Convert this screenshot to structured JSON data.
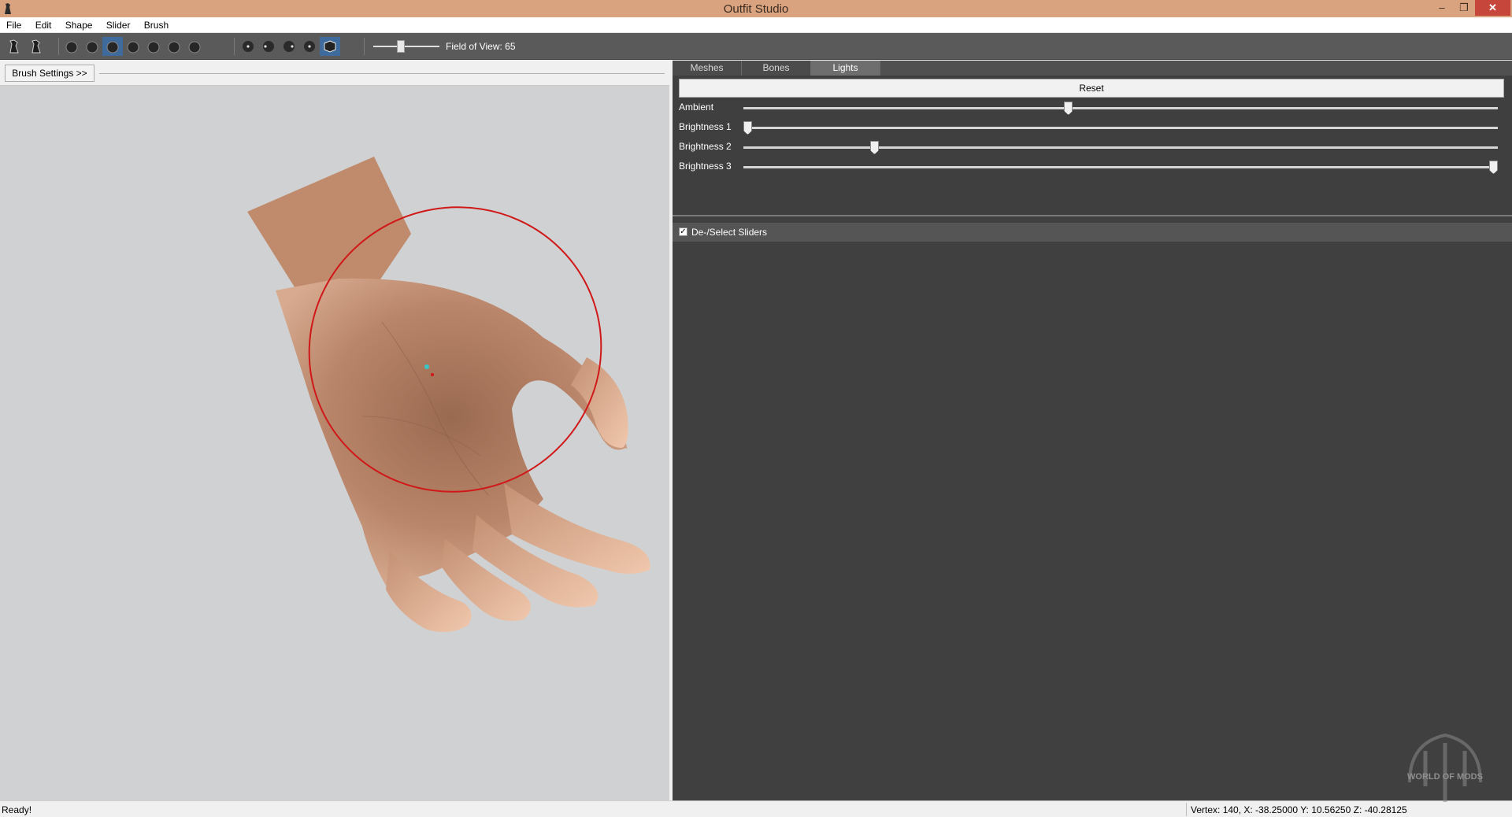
{
  "window": {
    "title": "Outfit Studio",
    "min_glyph": "–",
    "max_glyph": "❐",
    "close_glyph": "✕"
  },
  "menu": [
    "File",
    "Edit",
    "Shape",
    "Slider",
    "Brush"
  ],
  "toolbar": {
    "tools": [
      {
        "name": "select-tool-icon",
        "active": false
      },
      {
        "name": "transform-tool-icon",
        "active": false
      },
      {
        "name": "mask-brush-icon",
        "active": false
      },
      {
        "name": "move-brush-icon",
        "active": false
      },
      {
        "name": "inflate-brush-icon",
        "active": true
      },
      {
        "name": "deflate-brush-icon",
        "active": false
      },
      {
        "name": "smooth-brush-icon",
        "active": false
      },
      {
        "name": "undiff-brush-icon",
        "active": false
      },
      {
        "name": "weight-brush-icon",
        "active": false
      },
      {
        "name": "view-front-icon",
        "active": false
      },
      {
        "name": "view-back-icon",
        "active": false
      },
      {
        "name": "view-left-icon",
        "active": false
      },
      {
        "name": "view-right-icon",
        "active": false
      },
      {
        "name": "perspective-toggle-icon",
        "active": true
      }
    ],
    "fov_label": "Field of View: 65",
    "fov_value": 65,
    "fov_fraction": 0.42
  },
  "left": {
    "brush_settings_label": "Brush Settings >>"
  },
  "tabs": [
    {
      "label": "Meshes",
      "active": false
    },
    {
      "label": "Bones",
      "active": false
    },
    {
      "label": "Lights",
      "active": true
    }
  ],
  "lights": {
    "reset_label": "Reset",
    "rows": [
      {
        "label": "Ambient",
        "value": 0.43
      },
      {
        "label": "Brightness 1",
        "value": 0.0
      },
      {
        "label": "Brightness 2",
        "value": 0.17
      },
      {
        "label": "Brightness 3",
        "value": 1.0
      }
    ]
  },
  "sliders": {
    "deselect_label": "De-/Select Sliders",
    "deselect_checked": true,
    "check_glyph": "✓"
  },
  "status": {
    "left": "Ready!",
    "right": "Vertex: 140, X: -38.25000 Y: 10.56250 Z: -40.28125"
  },
  "watermark": "WORLD OF MODS"
}
